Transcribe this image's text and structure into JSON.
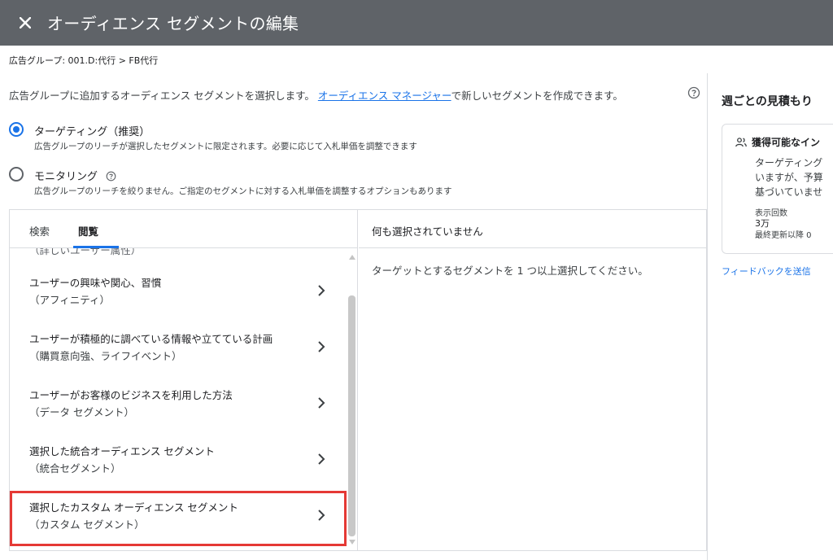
{
  "header": {
    "title": "オーディエンス セグメントの編集",
    "close_icon": "close-icon"
  },
  "breadcrumb": "広告グループ: 001.D:代行 > FB代行",
  "intro": {
    "text_before": "広告グループに追加するオーディエンス セグメントを選択します。",
    "link": "オーディエンス マネージャー",
    "text_after": "で新しいセグメントを作成できます。"
  },
  "options": [
    {
      "label": "ターゲティング（推奨）",
      "description": "広告グループのリーチが選択したセグメントに限定されます。必要に応じて入札単価を調整できます",
      "selected": true
    },
    {
      "label": "モニタリング",
      "description": "広告グループのリーチを絞りません。ご指定のセグメントに対する入札単価を調整するオプションもあります",
      "selected": false
    }
  ],
  "tabs": [
    {
      "label": "検索",
      "active": false
    },
    {
      "label": "閲覧",
      "active": true
    }
  ],
  "browse_list": {
    "partial_item": "（詳しいユーザー属性）",
    "items": [
      {
        "title": "ユーザーの興味や関心、習慣",
        "subtitle": "（アフィニティ）",
        "highlighted": false
      },
      {
        "title": "ユーザーが積極的に調べている情報や立てている計画",
        "subtitle": "（購買意向強、ライフイベント）",
        "highlighted": false
      },
      {
        "title": "ユーザーがお客様のビジネスを利用した方法",
        "subtitle": "（データ セグメント）",
        "highlighted": false
      },
      {
        "title": "選択した統合オーディエンス セグメント",
        "subtitle": "（統合セグメント）",
        "highlighted": false
      },
      {
        "title": "選択したカスタム オーディエンス セグメント",
        "subtitle": "（カスタム セグメント）",
        "highlighted": true
      }
    ]
  },
  "selection": {
    "header": "何も選択されていません",
    "placeholder": "ターゲットとするセグメントを 1 つ以上選択してください。"
  },
  "sidebar": {
    "title": "週ごとの見積もり",
    "card": {
      "heading": "獲得可能なイン",
      "lines": [
        "ターゲティング",
        "いますが、予算",
        "基づいていませ"
      ],
      "metric_label": "表示回数",
      "metric_value": "3万",
      "updated": "最終更新以降 0"
    },
    "feedback_link": "フィードバックを送信"
  },
  "colors": {
    "header_bg": "#5f6368",
    "accent": "#1a73e8",
    "highlight_border": "#e53935"
  }
}
